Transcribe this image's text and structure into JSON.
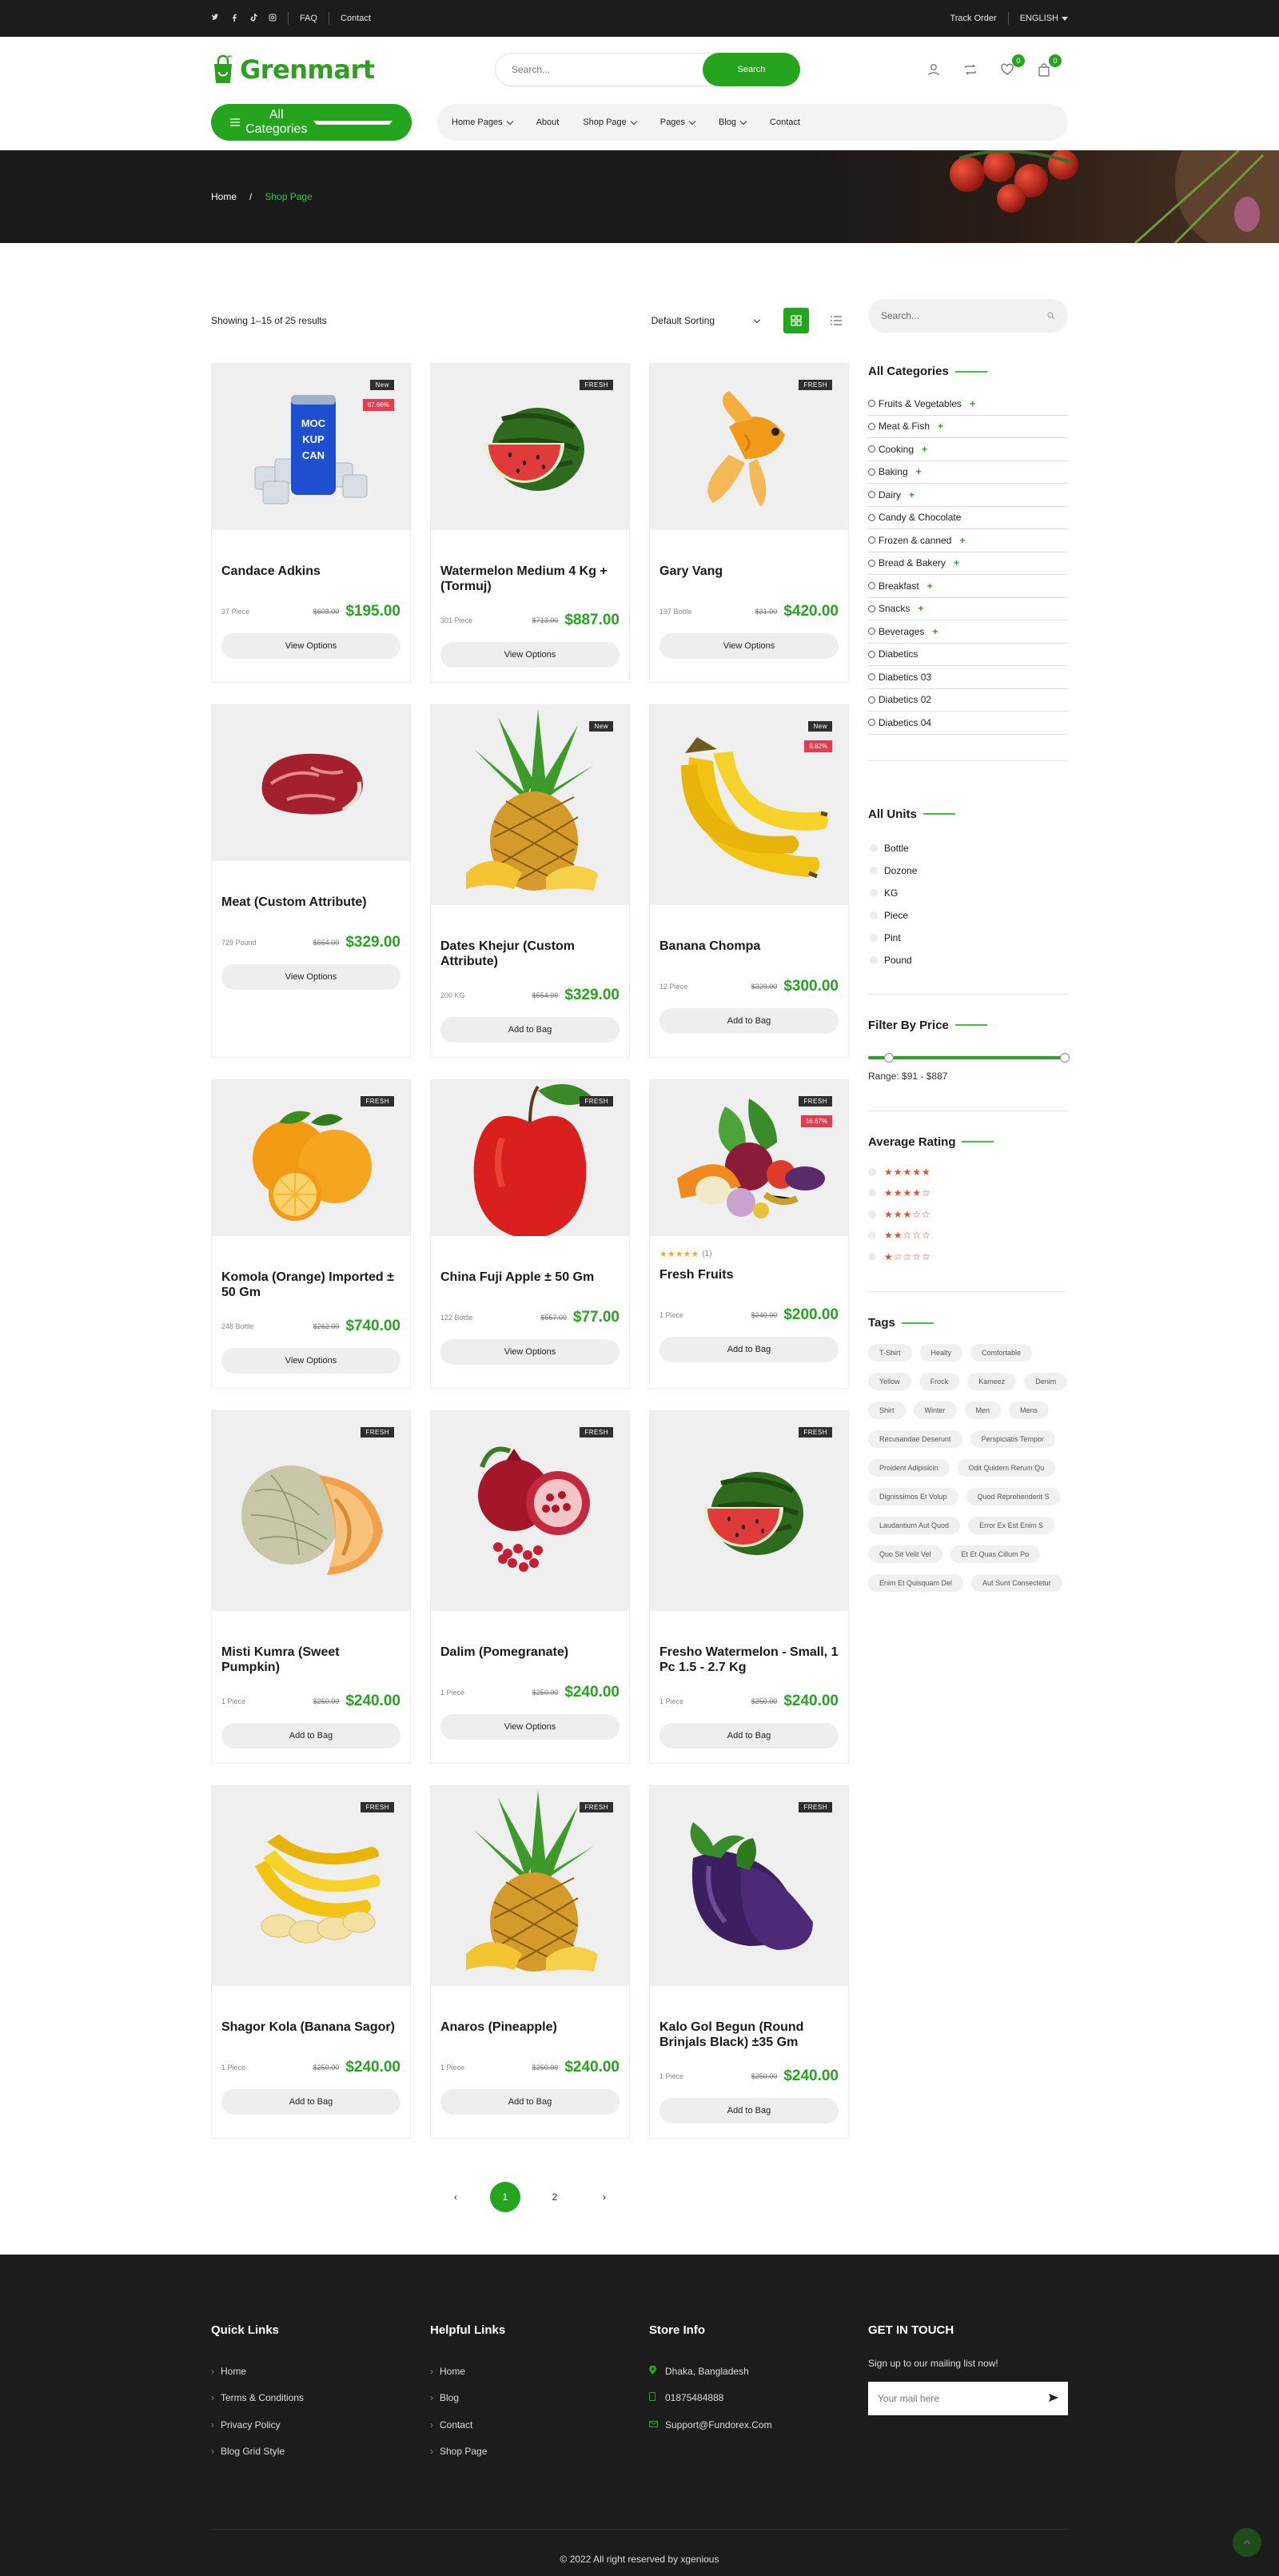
{
  "topbar": {
    "social": [
      "twitter",
      "facebook",
      "tiktok",
      "instagram"
    ],
    "links": [
      "FAQ",
      "Contact"
    ],
    "track_order": "Track Order",
    "language": "ENGLISH"
  },
  "header": {
    "logo": "Grenmart",
    "search_placeholder": "Search...",
    "search_button": "Search",
    "wishlist_count": "0",
    "cart_count": "0"
  },
  "nav": {
    "categories_button": "All Categories",
    "menu": [
      {
        "label": "Home Pages",
        "dropdown": true
      },
      {
        "label": "About",
        "dropdown": false
      },
      {
        "label": "Shop Page",
        "dropdown": true
      },
      {
        "label": "Pages",
        "dropdown": true
      },
      {
        "label": "Blog",
        "dropdown": true
      },
      {
        "label": "Contact",
        "dropdown": false
      }
    ]
  },
  "breadcrumb": {
    "home": "Home",
    "separator": "/",
    "current": "Shop Page"
  },
  "shop": {
    "results": "Showing 1–15 of 25 results",
    "sort": "Default Sorting"
  },
  "products": [
    {
      "name": "Candace Adkins",
      "unit": "37 Piece",
      "old": "$603.00",
      "price": "$195.00",
      "button": "View Options",
      "tag": "New",
      "discount": "67.66%",
      "art": "can"
    },
    {
      "name": "Watermelon Medium 4 Kg + (Tormuj)",
      "unit": "301 Piece",
      "old": "$713.00",
      "price": "$887.00",
      "button": "View Options",
      "tag": "FRESH",
      "art": "watermelon"
    },
    {
      "name": "Gary Vang",
      "unit": "197 Bottle",
      "old": "$31.00",
      "price": "$420.00",
      "button": "View Options",
      "tag": "FRESH",
      "art": "fish"
    },
    {
      "name": "Meat (Custom Attribute)",
      "unit": "729 Pound",
      "old": "$554.00",
      "price": "$329.00",
      "button": "View Options",
      "art": "meat"
    },
    {
      "name": "Dates Khejur (Custom Attribute)",
      "unit": "200 KG",
      "old": "$554.00",
      "price": "$329.00",
      "button": "Add to Bag",
      "tag": "New",
      "art": "pineapple"
    },
    {
      "name": "Banana Chompa",
      "unit": "12 Piece",
      "old": "$329.00",
      "price": "$300.00",
      "button": "Add to Bag",
      "tag": "New",
      "discount": "8.82%",
      "art": "banana"
    },
    {
      "name": "Komola (Orange) Imported ± 50 Gm",
      "unit": "248 Bottle",
      "old": "$262.00",
      "price": "$740.00",
      "button": "View Options",
      "tag": "FRESH",
      "art": "orange"
    },
    {
      "name": "China Fuji Apple ± 50 Gm",
      "unit": "122 Bottle",
      "old": "$667.00",
      "price": "$77.00",
      "button": "View Options",
      "tag": "FRESH",
      "art": "apple"
    },
    {
      "name": "Fresh Fruits",
      "unit": "1 Piece",
      "old": "$240.00",
      "price": "$200.00",
      "button": "Add to Bag",
      "tag": "FRESH",
      "discount": "16.67%",
      "rating": "★★★★★",
      "rating_count": "(1)",
      "art": "veg"
    },
    {
      "name": "Misti Kumra (Sweet Pumpkin)",
      "unit": "1 Piece",
      "old": "$250.00",
      "price": "$240.00",
      "button": "Add to Bag",
      "tag": "FRESH",
      "art": "melon"
    },
    {
      "name": "Dalim (Pomegranate)",
      "unit": "1 Piece",
      "old": "$250.00",
      "price": "$240.00",
      "button": "View Options",
      "tag": "FRESH",
      "art": "pomegranate"
    },
    {
      "name": "Fresho Watermelon - Small, 1 Pc 1.5 - 2.7 Kg",
      "unit": "1 Piece",
      "old": "$250.00",
      "price": "$240.00",
      "button": "Add to Bag",
      "tag": "FRESH",
      "art": "watermelon"
    },
    {
      "name": "Shagor Kola (Banana Sagor)",
      "unit": "1 Piece",
      "old": "$250.00",
      "price": "$240.00",
      "button": "Add to Bag",
      "tag": "FRESH",
      "art": "banana2"
    },
    {
      "name": "Anaros (Pineapple)",
      "unit": "1 Piece",
      "old": "$250.00",
      "price": "$240.00",
      "button": "Add to Bag",
      "tag": "FRESH",
      "art": "pineapple"
    },
    {
      "name": "Kalo Gol Begun (Round Brinjals Black) ±35 Gm",
      "unit": "1 Piece",
      "old": "$250.00",
      "price": "$240.00",
      "button": "Add to Bag",
      "tag": "FRESH",
      "art": "eggplant"
    }
  ],
  "pagination": {
    "prev": "‹",
    "pages": [
      "1",
      "2"
    ],
    "next": "›",
    "active": "1"
  },
  "sidebar": {
    "search_placeholder": "Search...",
    "categories_title": "All Categories",
    "categories": [
      {
        "label": "Fruits & Vegetables",
        "plus": true
      },
      {
        "label": "Meat & Fish",
        "plus": true
      },
      {
        "label": "Cooking",
        "plus": true
      },
      {
        "label": "Baking",
        "plus": true
      },
      {
        "label": "Dairy",
        "plus": true
      },
      {
        "label": "Candy & Chocolate",
        "plus": false
      },
      {
        "label": "Frozen & canned",
        "plus": true
      },
      {
        "label": "Bread & Bakery",
        "plus": true
      },
      {
        "label": "Breakfast",
        "plus": true
      },
      {
        "label": "Snacks",
        "plus": true
      },
      {
        "label": "Beverages",
        "plus": true
      },
      {
        "label": "Diabetics",
        "plus": false
      },
      {
        "label": "Diabetics 03",
        "plus": false
      },
      {
        "label": "Diabetics 02",
        "plus": false
      },
      {
        "label": "Diabetics 04",
        "plus": false
      }
    ],
    "units_title": "All Units",
    "units": [
      "Bottle",
      "Dozone",
      "KG",
      "Piece",
      "Pint",
      "Pound"
    ],
    "price_title": "Filter By Price",
    "price_range": "Range: $91 - $887",
    "rating_title": "Average Rating",
    "ratings": [
      "★★★★★",
      "★★★★☆",
      "★★★☆☆",
      "★★☆☆☆",
      "★☆☆☆☆"
    ],
    "tags_title": "Tags",
    "tags": [
      "T-Shirt",
      "Healty",
      "Comfortable",
      "Yellow",
      "Frock",
      "Kameez",
      "Denim",
      "Shirt",
      "Winter",
      "Men",
      "Mens",
      "Recusandae Deserunt",
      "Perspiciatis Tempor",
      "Proident Adipisicin",
      "Odit Quidem Rerum Qu",
      "Dignissimos Et Volup",
      "Quod Reprehenderit S",
      "Laudantium Aut Quod",
      "Error Ex Est Enim S",
      "Quo Sit Velit Vel",
      "Et Et Quas Cillum Po",
      "Enim Et Quisquam Del",
      "Aut Sunt Consectetur"
    ]
  },
  "footer": {
    "quick_title": "Quick Links",
    "quick_links": [
      "Home",
      "Terms & Conditions",
      "Privacy Policy",
      "Blog Grid Style"
    ],
    "helpful_title": "Helpful Links",
    "helpful_links": [
      "Home",
      "Blog",
      "Contact",
      "Shop Page"
    ],
    "store_title": "Store Info",
    "store_info": [
      {
        "icon": "location-icon",
        "text": "Dhaka, Bangladesh"
      },
      {
        "icon": "phone-icon",
        "text": "01875484888"
      },
      {
        "icon": "mail-icon",
        "text": "Support@Fundorex.Com"
      }
    ],
    "touch_title": "GET IN TOUCH",
    "touch_text": "Sign up to our mailing list now!",
    "email_placeholder": "Your mail here",
    "copyright": "© 2022 All right reserved by xgenious"
  },
  "colors": {
    "accent": "#24a51d",
    "dark": "#1c1c1c",
    "sale": "#e23c4f",
    "star": "#e64d2e"
  }
}
